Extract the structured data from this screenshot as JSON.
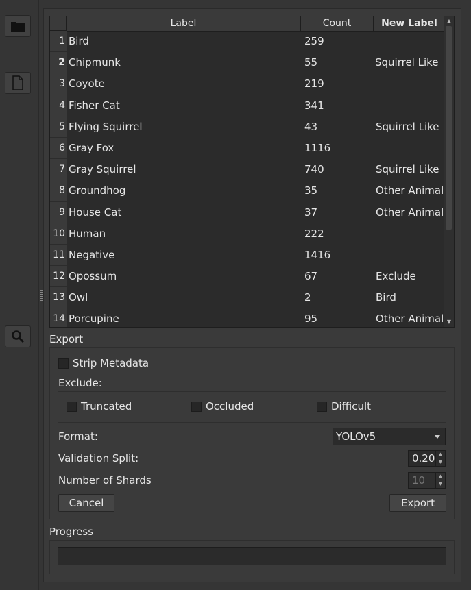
{
  "toolbar": {
    "icons": [
      "folder-icon",
      "file-icon",
      "search-icon"
    ]
  },
  "table": {
    "headers": {
      "label": "Label",
      "count": "Count",
      "new_label": "New Label"
    },
    "rows": [
      {
        "num": "1",
        "label": "Bird",
        "count": "259",
        "new_label": ""
      },
      {
        "num": "2",
        "label": "Chipmunk",
        "count": "55",
        "new_label": "Squirrel Like"
      },
      {
        "num": "3",
        "label": "Coyote",
        "count": "219",
        "new_label": ""
      },
      {
        "num": "4",
        "label": "Fisher Cat",
        "count": "341",
        "new_label": ""
      },
      {
        "num": "5",
        "label": "Flying Squirrel",
        "count": "43",
        "new_label": "Squirrel Like"
      },
      {
        "num": "6",
        "label": "Gray Fox",
        "count": "1116",
        "new_label": ""
      },
      {
        "num": "7",
        "label": "Gray Squirrel",
        "count": "740",
        "new_label": "Squirrel Like"
      },
      {
        "num": "8",
        "label": "Groundhog",
        "count": "35",
        "new_label": "Other Animal"
      },
      {
        "num": "9",
        "label": "House Cat",
        "count": "37",
        "new_label": "Other Animal"
      },
      {
        "num": "10",
        "label": "Human",
        "count": "222",
        "new_label": ""
      },
      {
        "num": "11",
        "label": "Negative",
        "count": "1416",
        "new_label": ""
      },
      {
        "num": "12",
        "label": "Opossum",
        "count": "67",
        "new_label": "Exclude"
      },
      {
        "num": "13",
        "label": "Owl",
        "count": "2",
        "new_label": "Bird"
      },
      {
        "num": "14",
        "label": "Porcupine",
        "count": "95",
        "new_label": "Other Animal"
      }
    ]
  },
  "export": {
    "title": "Export",
    "strip_metadata": "Strip Metadata",
    "exclude_label": "Exclude:",
    "truncated": "Truncated",
    "occluded": "Occluded",
    "difficult": "Difficult",
    "format_label": "Format:",
    "format_value": "YOLOv5",
    "validation_label": "Validation Split:",
    "validation_value": "0.20",
    "shards_label": "Number of Shards",
    "shards_value": "10",
    "cancel": "Cancel",
    "export_btn": "Export"
  },
  "progress": {
    "title": "Progress",
    "value": 0
  }
}
